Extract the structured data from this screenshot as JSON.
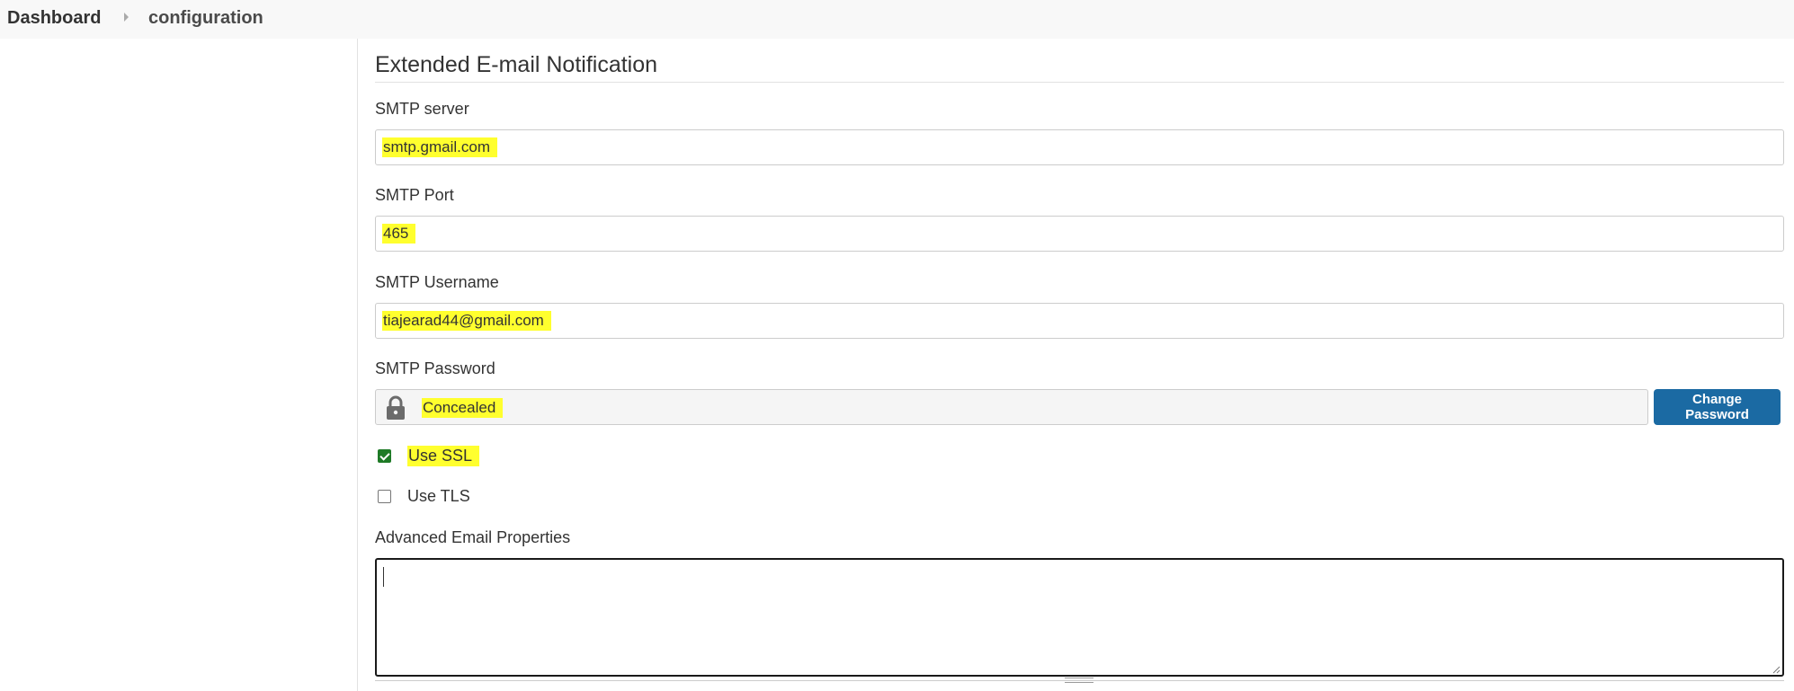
{
  "breadcrumb": {
    "items": [
      {
        "label": "Dashboard"
      },
      {
        "label": "configuration"
      }
    ]
  },
  "section": {
    "title": "Extended E-mail Notification"
  },
  "fields": {
    "smtp_server": {
      "label": "SMTP server",
      "value": "smtp.gmail.com"
    },
    "smtp_port": {
      "label": "SMTP Port",
      "value": "465"
    },
    "smtp_username": {
      "label": "SMTP Username",
      "value": "tiajearad44@gmail.com"
    },
    "smtp_password": {
      "label": "SMTP Password",
      "value": "Concealed",
      "button_label": "Change Password"
    }
  },
  "options": {
    "use_ssl": {
      "label": "Use SSL",
      "checked": true
    },
    "use_tls": {
      "label": "Use TLS",
      "checked": false
    }
  },
  "advanced": {
    "label": "Advanced Email Properties",
    "value": ""
  },
  "colors": {
    "highlight": "#ffff2e",
    "primary_button": "#1b6aa3",
    "checkbox_checked": "#1e7a26"
  },
  "icons": {
    "lock": "lock-icon",
    "separator": "chevron-right-icon"
  }
}
